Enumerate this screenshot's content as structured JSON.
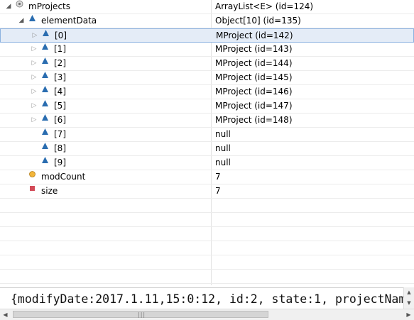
{
  "variables": {
    "rows": [
      {
        "name": "mProjects",
        "value": "ArrayList<E>  (id=124)",
        "icon": "object-icon",
        "expander": "expanded"
      },
      {
        "name": "elementData",
        "value": "Object[10]  (id=135)",
        "icon": "field-triangle-icon",
        "expander": "expanded"
      },
      {
        "name": "[0]",
        "value": "MProject  (id=142)",
        "icon": "field-triangle-icon",
        "expander": "collapsed",
        "selected": true
      },
      {
        "name": "[1]",
        "value": "MProject  (id=143)",
        "icon": "field-triangle-icon",
        "expander": "collapsed"
      },
      {
        "name": "[2]",
        "value": "MProject  (id=144)",
        "icon": "field-triangle-icon",
        "expander": "collapsed"
      },
      {
        "name": "[3]",
        "value": "MProject  (id=145)",
        "icon": "field-triangle-icon",
        "expander": "collapsed"
      },
      {
        "name": "[4]",
        "value": "MProject  (id=146)",
        "icon": "field-triangle-icon",
        "expander": "collapsed"
      },
      {
        "name": "[5]",
        "value": "MProject  (id=147)",
        "icon": "field-triangle-icon",
        "expander": "collapsed"
      },
      {
        "name": "[6]",
        "value": "MProject  (id=148)",
        "icon": "field-triangle-icon",
        "expander": "collapsed"
      },
      {
        "name": "[7]",
        "value": "null",
        "icon": "field-triangle-icon",
        "expander": "none"
      },
      {
        "name": "[8]",
        "value": "null",
        "icon": "field-triangle-icon",
        "expander": "none"
      },
      {
        "name": "[9]",
        "value": "null",
        "icon": "field-triangle-icon",
        "expander": "none"
      },
      {
        "name": "modCount",
        "value": "7",
        "icon": "protected-field-dot-icon",
        "expander": "none"
      },
      {
        "name": "size",
        "value": "7",
        "icon": "private-field-square-icon",
        "expander": "none"
      }
    ]
  },
  "detail": {
    "text": "{modifyDate:2017.1.11,15:0:12, id:2, state:1, projectNam"
  },
  "colors": {
    "selection": "#e4ecf7",
    "triangle_icon": "#2a6db0",
    "dot_icon": "#f2b53a",
    "square_icon": "#d24a57"
  }
}
